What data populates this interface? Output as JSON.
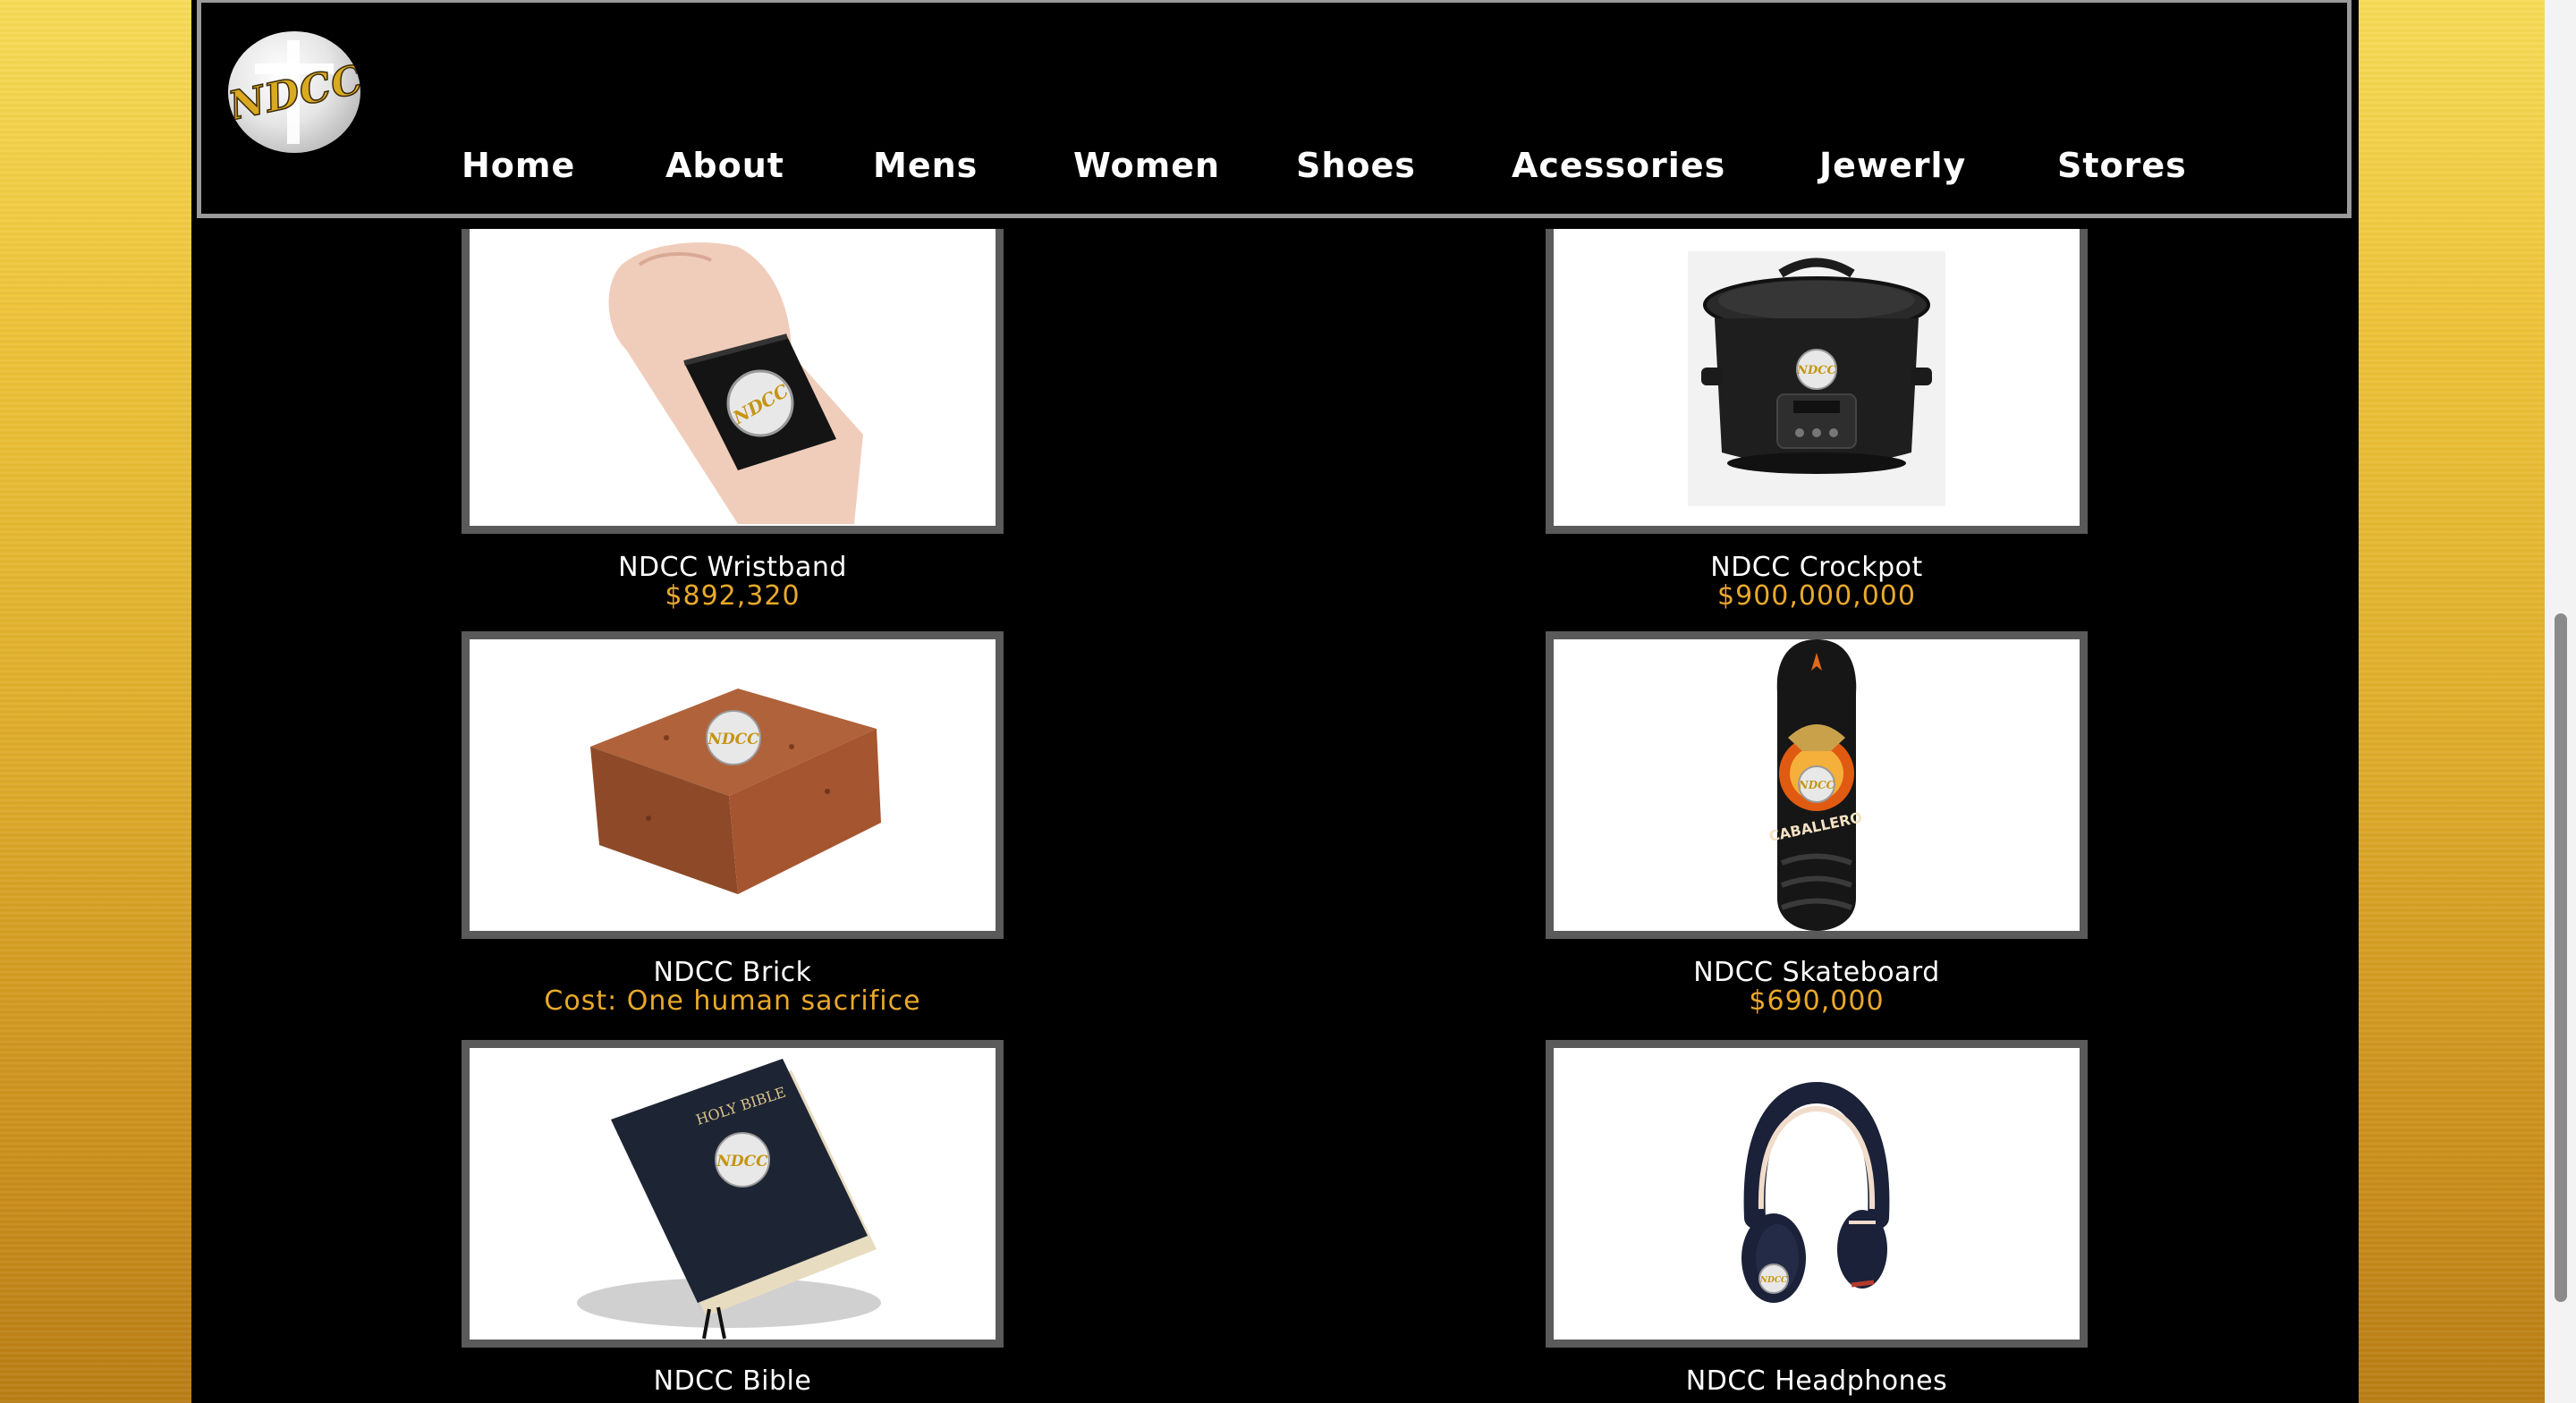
{
  "header": {
    "logo_text": "NDCC",
    "nav": [
      "Home",
      "About",
      "Mens",
      "Women",
      "Shoes",
      "Acessories",
      "Jewerly",
      "Stores"
    ]
  },
  "products": [
    {
      "name": "NDCC Wristband",
      "price": "$892,320",
      "image": "wristband"
    },
    {
      "name": "NDCC Crockpot",
      "price": "$900,000,000",
      "image": "crockpot"
    },
    {
      "name": "NDCC Brick",
      "price": "Cost: One human sacrifice",
      "image": "brick"
    },
    {
      "name": "NDCC Skateboard",
      "price": "$690,000",
      "image": "skateboard"
    },
    {
      "name": "NDCC Bible",
      "price": "",
      "image": "bible"
    },
    {
      "name": "NDCC Headphones",
      "price": "",
      "image": "headphones"
    }
  ],
  "badge_text": "NDCC",
  "bible_cover_text": "HOLY BIBLE",
  "skateboard_text": "CABALLERO"
}
